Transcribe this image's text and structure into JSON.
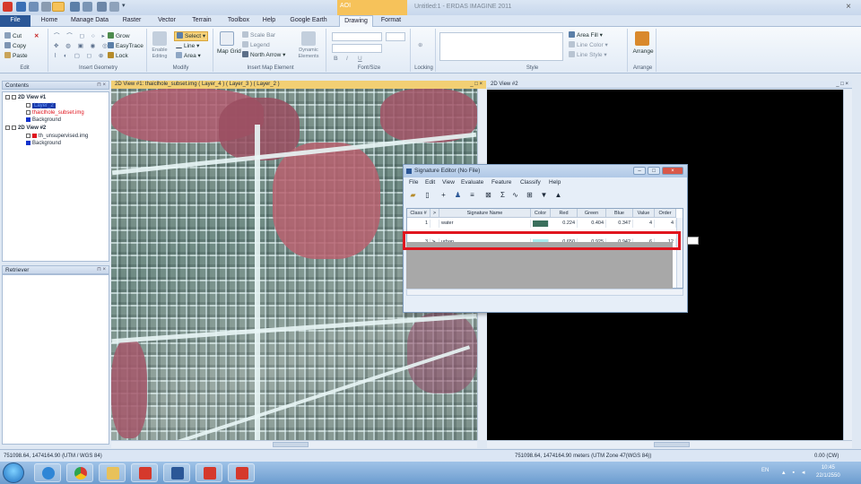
{
  "title_bar": {
    "contextual_tab_group": "AOI",
    "window_title": "Untitled:1 - ERDAS IMAGINE 2011",
    "close_glyph": "×"
  },
  "menu_tabs": [
    "File",
    "Home",
    "Manage Data",
    "Raster",
    "Vector",
    "Terrain",
    "Toolbox",
    "Help",
    "Google Earth",
    "Drawing",
    "Format"
  ],
  "ribbon": {
    "edit": {
      "cut": "Cut",
      "copy": "Copy",
      "paste": "Paste",
      "label": "Edit"
    },
    "insert_geometry": {
      "grow": "Grow",
      "easytrace": "EasyTrace",
      "lock": "Lock",
      "label": "Insert Geometry"
    },
    "modify": {
      "enable_editing": "Enable Editing",
      "select": "Select",
      "line": "Line",
      "area": "Area",
      "label": "Modify"
    },
    "map_element": {
      "map_grid": "Map Grid",
      "scale_bar": "Scale Bar",
      "legend": "Legend",
      "north_arrow": "North Arrow",
      "dynamic_elements": "Dynamic Elements",
      "label": "Insert Map Element"
    },
    "font_size": {
      "bold": "B",
      "italic": "I",
      "underline": "U",
      "label": "Font/Size"
    },
    "locking": {
      "label": "Locking"
    },
    "style": {
      "area_fill": "Area Fill",
      "line_color": "Line Color",
      "line_style": "Line Style",
      "label": "Style"
    },
    "arrange": {
      "arrange": "Arrange",
      "label": "Arrange"
    }
  },
  "contents_panel": {
    "title": "Contents",
    "pin": "⊓ ×",
    "tree": [
      {
        "label": "2D View #1",
        "level": 0
      },
      {
        "label": "Layer_2",
        "level": 2,
        "selected": true
      },
      {
        "label": "thaiclhole_subset.img",
        "level": 2,
        "color": "#e0151e"
      },
      {
        "label": "Background",
        "level": 2
      },
      {
        "label": "2D View #2",
        "level": 0
      },
      {
        "label": "th_unsupervised.img",
        "level": 2
      },
      {
        "label": "Background",
        "level": 2
      }
    ]
  },
  "retriever_panel": {
    "title": "Retriever",
    "pin": "⊓ ×"
  },
  "view1": {
    "title": "2D View #1: thaiclhole_subset.img ( Layer_4 ) ( Layer_3 ) ( Layer_2 )",
    "controls": "_ □ ×"
  },
  "view2": {
    "title": "2D View #2",
    "controls": "_ □ ×"
  },
  "signature_editor": {
    "title": "Signature Editor (No File)",
    "menu": [
      "File",
      "Edit",
      "View",
      "Evaluate",
      "Feature",
      "Classify",
      "Help"
    ],
    "columns": [
      "Class #",
      ">",
      "Signature Name",
      "Color",
      "Red",
      "Green",
      "Blue",
      "Value",
      "Order"
    ],
    "rows": [
      {
        "class": "1",
        "marker": "",
        "name": "water",
        "color": "#3a6f5c",
        "red": "0.224",
        "green": "0.404",
        "blue": "0.347",
        "value": "4",
        "order": "4"
      },
      {
        "class": "3",
        "marker": "≻",
        "name": "urban",
        "color": "#a9ecef",
        "red": "0.650",
        "green": "0.925",
        "blue": "0.942",
        "value": "6",
        "order": "12"
      }
    ]
  },
  "status_bar": {
    "left": "751098.64, 1474164.90 (UTM / WGS 84)",
    "middle": "751098.64, 1474164.90 meters (UTM Zone 47(WGS 84))",
    "right": "0.00 (CW)"
  },
  "taskbar": {
    "lang": "EN",
    "time": "10:45",
    "date": "22/1/2550"
  }
}
